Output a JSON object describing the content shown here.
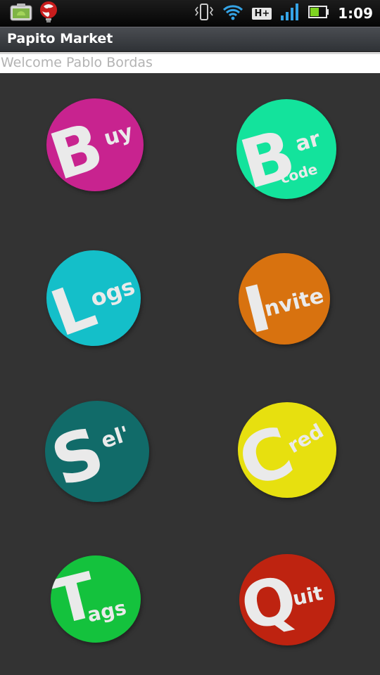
{
  "status_bar": {
    "time": "1:09",
    "network_label": "H+",
    "icons": [
      "screenshot-icon",
      "android-debug-icon",
      "market-globe-icon",
      "vibrate-icon",
      "wifi-icon",
      "network-type-icon",
      "signal-icon",
      "battery-icon"
    ]
  },
  "app": {
    "title": "Papito Market",
    "welcome": "Welcome Pablo Bordas"
  },
  "tiles": [
    {
      "name": "buy",
      "letter": "B",
      "text": "uy",
      "color": "#c8238f"
    },
    {
      "name": "barcode",
      "letter": "B",
      "text": "ar",
      "text2": "code",
      "color": "#13e39c"
    },
    {
      "name": "logs",
      "letter": "L",
      "text": "ogs",
      "color": "#14bfc9"
    },
    {
      "name": "invite",
      "letter": "I",
      "text": "nvite",
      "color": "#d8720f"
    },
    {
      "name": "sell",
      "letter": "S",
      "text": "el'",
      "color": "#116b69"
    },
    {
      "name": "cred",
      "letter": "C",
      "text": "red",
      "color": "#e7e00f"
    },
    {
      "name": "tags",
      "letter": "T",
      "text": "ags",
      "color": "#14c23d"
    },
    {
      "name": "quit",
      "letter": "Q",
      "text": "uit",
      "color": "#be2310"
    }
  ]
}
